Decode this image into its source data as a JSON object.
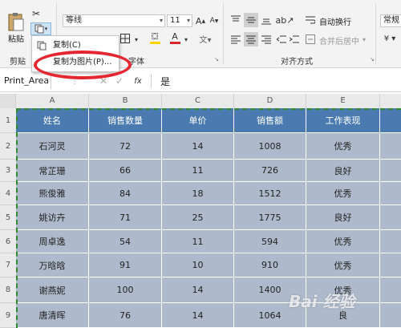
{
  "ribbon": {
    "paste_label": "粘贴",
    "clipboard_group": "剪贴",
    "font_name": "等线",
    "font_size": "11",
    "font_group": "字体",
    "wrap_text": "自动换行",
    "merge_center": "合并后居中",
    "align_group": "对齐方式",
    "number_format": "常规",
    "bold": "B",
    "font_color_glyph": "A"
  },
  "context_menu": {
    "copy": "复制(C)",
    "copy_as_picture": "复制为图片(P)..."
  },
  "formula_bar": {
    "name_box": "Print_Area",
    "fx": "fx",
    "value": "是"
  },
  "columns": [
    "A",
    "B",
    "C",
    "D",
    "E"
  ],
  "rows": [
    "1",
    "2",
    "3",
    "4",
    "5",
    "6",
    "7",
    "8",
    "9"
  ],
  "table": {
    "headers": [
      "姓名",
      "销售数量",
      "单价",
      "销售额",
      "工作表现"
    ],
    "rows": [
      [
        "石河灵",
        "72",
        "14",
        "1008",
        "优秀"
      ],
      [
        "常芷珊",
        "66",
        "11",
        "726",
        "良好"
      ],
      [
        "熊俊雅",
        "84",
        "18",
        "1512",
        "优秀"
      ],
      [
        "姚访卉",
        "71",
        "25",
        "1775",
        "良好"
      ],
      [
        "周卓逸",
        "54",
        "11",
        "594",
        "优秀"
      ],
      [
        "万晗晗",
        "91",
        "10",
        "910",
        "优秀"
      ],
      [
        "谢燕妮",
        "100",
        "14",
        "1400",
        "优秀"
      ],
      [
        "唐清晖",
        "76",
        "14",
        "1064",
        "良"
      ]
    ]
  },
  "watermark": "Bai 经验",
  "colors": {
    "header_fill": "#4a7ab0",
    "data_fill": "#aebacb",
    "highlight_oval": "#e3262f",
    "font_color_bar": "#d9262c",
    "fill_color_bar": "#ffd400"
  }
}
